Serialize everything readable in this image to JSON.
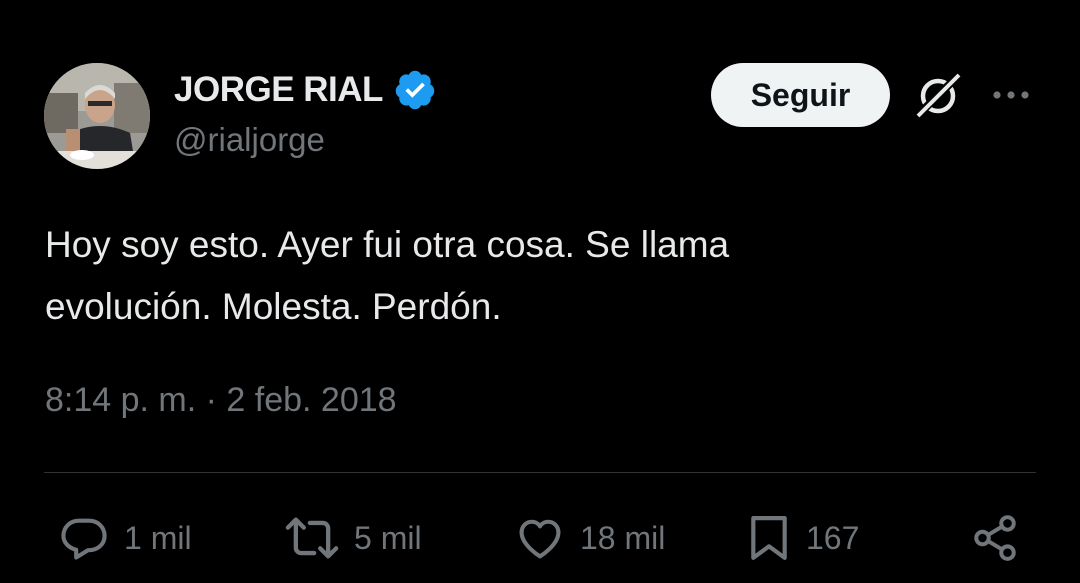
{
  "author": {
    "display_name": "JORGE RIAL",
    "handle": "@rialjorge",
    "verified_icon": "verified-badge-icon",
    "avatar": "profile-photo"
  },
  "header": {
    "follow_label": "Seguir",
    "grok_icon": "grok-icon",
    "more_icon": "more-options-icon"
  },
  "tweet": {
    "text_lines": [
      "Hoy soy esto. Ayer fui otra cosa. Se llama",
      "evolución. Molesta. Perdón."
    ],
    "timestamp": "8:14 p. m. · 2 feb. 2018"
  },
  "actions": {
    "reply": {
      "icon": "reply-icon",
      "count": "1 mil"
    },
    "retweet": {
      "icon": "retweet-icon",
      "count": "5 mil"
    },
    "like": {
      "icon": "heart-icon",
      "count": "18 mil"
    },
    "bookmark": {
      "icon": "bookmark-icon",
      "count": "167"
    },
    "share": {
      "icon": "share-icon"
    }
  },
  "colors": {
    "background": "#000000",
    "primary_text": "#e7e9ea",
    "secondary_text": "#71767b",
    "verified_blue": "#1d9bf0",
    "follow_button_bg": "#eff3f4",
    "divider": "#2f3336"
  }
}
